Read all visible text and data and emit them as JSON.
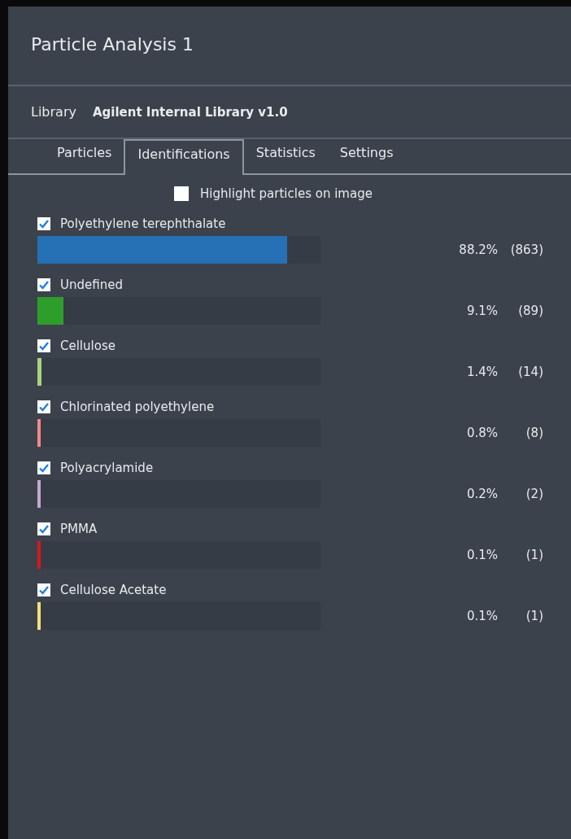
{
  "window": {
    "title": "Particle Analysis 1"
  },
  "library": {
    "label": "Library",
    "value": "Agilent Internal Library v1.0"
  },
  "tabs": [
    {
      "label": "Particles",
      "selected": false
    },
    {
      "label": "Identifications",
      "selected": true
    },
    {
      "label": "Statistics",
      "selected": false
    },
    {
      "label": "Settings",
      "selected": false
    }
  ],
  "highlight": {
    "label": "Highlight particles on image",
    "checked": false
  },
  "identifications": [
    {
      "name": "Polyethylene terephthalate",
      "checked": true,
      "color": "#2670b5",
      "level": 0.882,
      "percent": "88.2%",
      "count": "(863)"
    },
    {
      "name": "Undefined",
      "checked": true,
      "color": "#2e9e2a",
      "level": 0.091,
      "percent": "9.1%",
      "count": "(89)"
    },
    {
      "name": "Cellulose",
      "checked": true,
      "color": "#a6d37e",
      "level": 0.014,
      "percent": "1.4%",
      "count": "(14)"
    },
    {
      "name": "Chlorinated polyethylene",
      "checked": true,
      "color": "#ef8a8a",
      "level": 0.008,
      "percent": "0.8%",
      "count": "(8)"
    },
    {
      "name": "Polyacrylamide",
      "checked": true,
      "color": "#c4a8cf",
      "level": 0.002,
      "percent": "0.2%",
      "count": "(2)"
    },
    {
      "name": "PMMA",
      "checked": true,
      "color": "#d9181c",
      "level": 0.001,
      "percent": "0.1%",
      "count": "(1)"
    },
    {
      "name": "Cellulose Acetate",
      "checked": true,
      "color": "#f4e27a",
      "level": 0.001,
      "percent": "0.1%",
      "count": "(1)"
    }
  ]
}
